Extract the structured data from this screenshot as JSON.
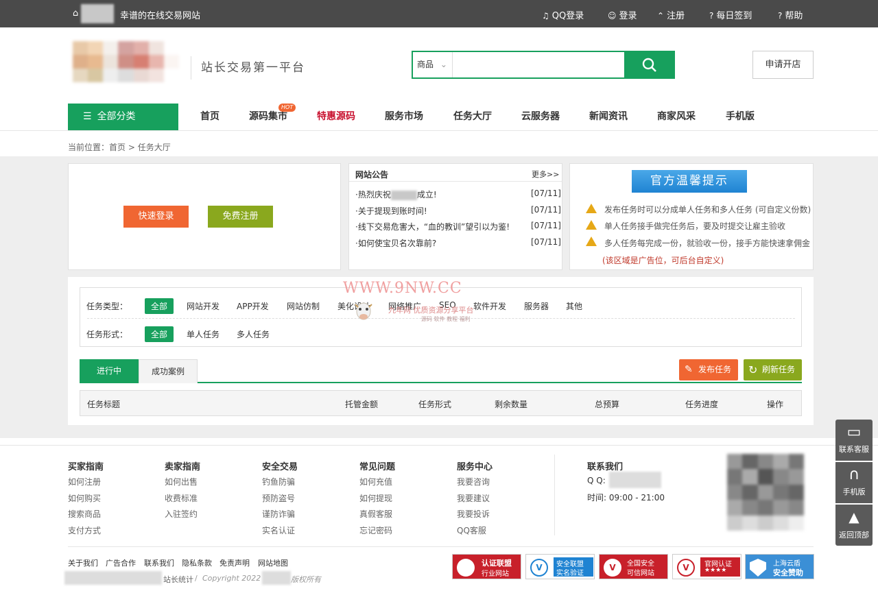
{
  "topbar": {
    "site_title": "幸谱的在线交易网站",
    "links": [
      {
        "label": "QQ登录",
        "icon": "bell-icon"
      },
      {
        "label": "登录",
        "icon": "user-icon"
      },
      {
        "label": "注册",
        "icon": "chevron-up-icon"
      },
      {
        "label": "每日签到",
        "icon": "question-circle-icon"
      },
      {
        "label": "帮助",
        "icon": "question-circle-icon"
      }
    ]
  },
  "header": {
    "slogan": "站长交易第一平台",
    "search_category": "商品",
    "search_placeholder": "",
    "apply_label": "申请开店"
  },
  "nav": {
    "all_categories": "全部分类",
    "items": [
      "首页",
      "源码集市",
      "特惠源码",
      "服务市场",
      "任务大厅",
      "云服务器",
      "新闻资讯",
      "商家风采",
      "手机版"
    ],
    "hot_badge": "HOT",
    "highlight_color": "#c8102e"
  },
  "breadcrumb": {
    "prefix": "当前位置：",
    "home": "首页",
    "sep": ">",
    "current": "任务大厅"
  },
  "login": {
    "quick_login": "快速登录",
    "free_register": "免费注册"
  },
  "notice": {
    "title": "网站公告",
    "more": "更多>>",
    "items": [
      {
        "text": "·热烈庆祝",
        "text2": "成立!",
        "date": "[07/11]"
      },
      {
        "text": "·关于提现到账时间!",
        "date": "[07/11]"
      },
      {
        "text": "·线下交易危害大，“血的教训”望引以为鉴!",
        "date": "[07/11]"
      },
      {
        "text": "·如何使宝贝名次靠前?",
        "date": "[07/11]"
      }
    ]
  },
  "tips": {
    "title": "官方温馨提示",
    "items": [
      "发布任务时可以分成单人任务和多人任务 (可自定义份数)",
      "单人任务接手做完任务后，要及时提交让雇主验收",
      "多人任务每完成一份，就验收一份，接手方能快速拿佣金"
    ],
    "note": "(该区域是广告位，可后台自定义)"
  },
  "watermark": {
    "line1": "WWW.9NW.CC",
    "line2": "九年网 优质资源分享平台",
    "line3": "源码 软件 教程 福利"
  },
  "filter": {
    "type_label": "任务类型：",
    "types": [
      "全部",
      "网站开发",
      "APP开发",
      "网站仿制",
      "美化设计",
      "网络推广",
      "SEO",
      "软件开发",
      "服务器",
      "其他"
    ],
    "form_label": "任务形式：",
    "forms": [
      "全部",
      "单人任务",
      "多人任务"
    ]
  },
  "tabs": {
    "active": "进行中",
    "other": "成功案例",
    "publish": "发布任务",
    "refresh": "刷新任务"
  },
  "table": {
    "headers": [
      "任务标题",
      "托管金额",
      "任务形式",
      "剩余数量",
      "总预算",
      "任务进度",
      "操作"
    ]
  },
  "footer": {
    "columns": [
      {
        "title": "买家指南",
        "links": [
          "如何注册",
          "如何购买",
          "搜索商品",
          "支付方式"
        ]
      },
      {
        "title": "卖家指南",
        "links": [
          "如何出售",
          "收费标准",
          "入驻签约"
        ]
      },
      {
        "title": "安全交易",
        "links": [
          "钓鱼防骗",
          "预防盗号",
          "谨防诈骗",
          "实名认证"
        ]
      },
      {
        "title": "常见问题",
        "links": [
          "如何充值",
          "如何提现",
          "真假客服",
          "忘记密码"
        ]
      },
      {
        "title": "服务中心",
        "links": [
          "我要咨询",
          "我要建议",
          "我要投诉",
          "QQ客服"
        ]
      }
    ],
    "contact": {
      "title": "联系我们",
      "qq_label": "Q Q:",
      "hours_label": "时间:",
      "hours": "09:00 - 21:00"
    },
    "bottom_links": [
      "关于我们",
      "广告合作",
      "联系我们",
      "隐私条款",
      "免责声明",
      "网站地图"
    ],
    "stats": "站长统计",
    "copyright_sep": "/",
    "copyright": "Copyright 2022",
    "rights": "版权所有",
    "badges": [
      {
        "l1": "认证联盟",
        "l2": "行业网站"
      },
      {
        "l1": "安全联盟",
        "l2": "实名验证"
      },
      {
        "l1": "全国安全",
        "l2": "可信网站"
      },
      {
        "l1": "官网认证",
        "l2": "★★★★"
      },
      {
        "l1": "上海云盾",
        "l2": "安全赞助"
      }
    ]
  },
  "sidebar": {
    "items": [
      "联系客服",
      "手机版",
      "返回顶部"
    ]
  }
}
